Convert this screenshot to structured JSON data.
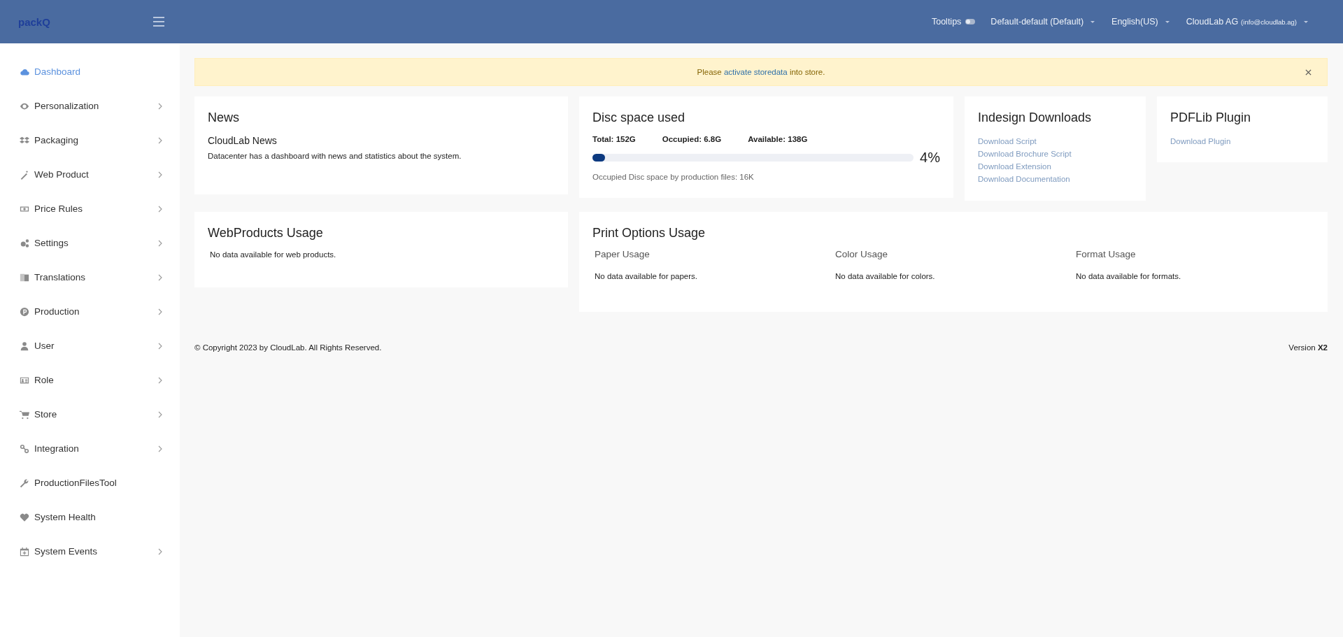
{
  "header": {
    "logo": "packQ",
    "tooltips": {
      "label": "Tooltips",
      "on": false
    },
    "menus": [
      {
        "kind": "plain",
        "label": "Default-default (Default)"
      },
      {
        "kind": "plain",
        "label": "English(US)"
      },
      {
        "kind": "account",
        "label": "CloudLab AG",
        "detail": "(info@cloudlab.ag)"
      }
    ]
  },
  "sidebar": {
    "items": [
      {
        "label": "Dashboard",
        "selected": true,
        "has_submenu": false
      },
      {
        "label": "Personalization",
        "selected": false,
        "has_submenu": true
      },
      {
        "label": "Packaging",
        "selected": false,
        "has_submenu": true
      },
      {
        "label": "Web Product",
        "selected": false,
        "has_submenu": true
      },
      {
        "label": "Price Rules",
        "selected": false,
        "has_submenu": true
      },
      {
        "label": "Settings",
        "selected": false,
        "has_submenu": true
      },
      {
        "label": "Translations",
        "selected": false,
        "has_submenu": true
      },
      {
        "label": "Production",
        "selected": false,
        "has_submenu": true
      },
      {
        "label": "User",
        "selected": false,
        "has_submenu": true
      },
      {
        "label": "Role",
        "selected": false,
        "has_submenu": true
      },
      {
        "label": "Store",
        "selected": false,
        "has_submenu": true
      },
      {
        "label": "Integration",
        "selected": false,
        "has_submenu": true
      },
      {
        "label": "ProductionFilesTool",
        "selected": false,
        "has_submenu": false
      },
      {
        "label": "System Health",
        "selected": false,
        "has_submenu": false
      },
      {
        "label": "System Events",
        "selected": false,
        "has_submenu": true
      }
    ]
  },
  "alert": {
    "before": "Please",
    "link": "activate storedata",
    "after": "into store."
  },
  "news": {
    "title": "News",
    "subtitle": "CloudLab News",
    "text": "Datacenter has a dashboard with news and statistics about the system."
  },
  "disc": {
    "title": "Disc space used",
    "stats": [
      "Total: 152G",
      "Occupied: 6.8G",
      "Available: 138G"
    ],
    "level": 0.04,
    "reading": "4%",
    "note": "Occupied Disc space by production files: 16K"
  },
  "indesign": {
    "title": "Indesign Downloads",
    "links": [
      "Download Script",
      "Download Brochure Script",
      "Download Extension",
      "Download Documentation"
    ]
  },
  "pdflib": {
    "title": "PDFLib Plugin",
    "links": [
      "Download Plugin"
    ]
  },
  "webproducts": {
    "title": "WebProducts Usage",
    "text": "No data available for web products."
  },
  "print_options": {
    "title": "Print Options Usage",
    "columns": [
      {
        "heading": "Paper Usage",
        "text": "No data available for papers."
      },
      {
        "heading": "Color Usage",
        "text": "No data available for colors."
      },
      {
        "heading": "Format Usage",
        "text": "No data available for formats."
      }
    ]
  },
  "footer": {
    "copyright": "© Copyright 2023 by CloudLab. All Rights Reserved.",
    "version": "Version **X2**"
  }
}
